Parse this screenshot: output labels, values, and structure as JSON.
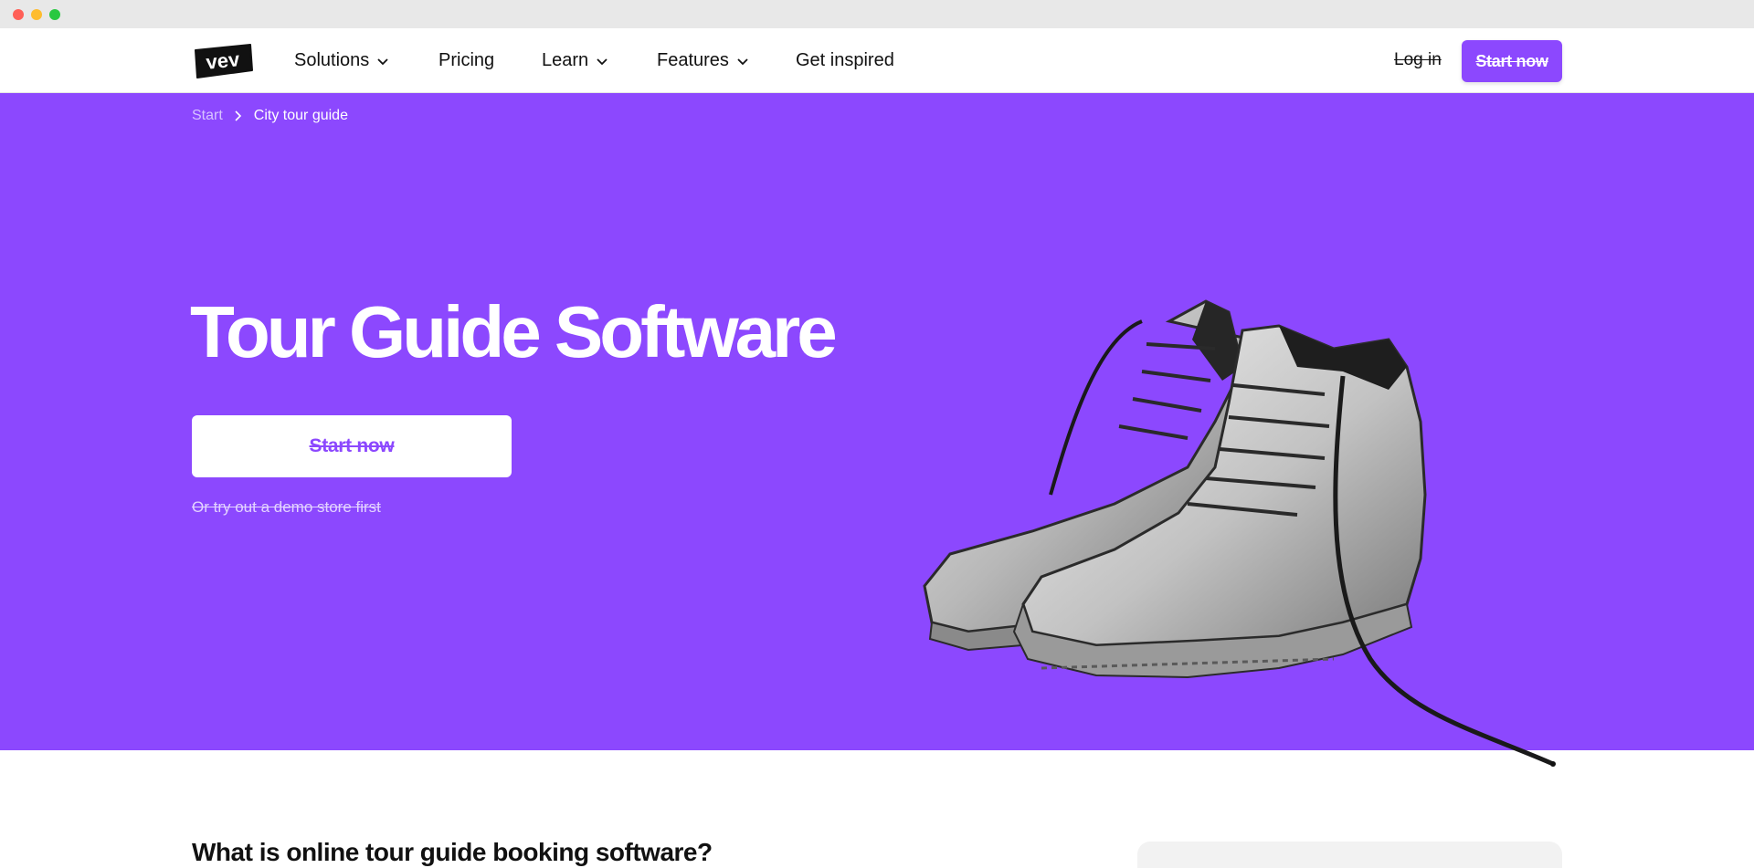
{
  "nav": {
    "logo_text": "vev",
    "items": [
      {
        "label": "Solutions",
        "has_dropdown": true
      },
      {
        "label": "Pricing",
        "has_dropdown": false
      },
      {
        "label": "Learn",
        "has_dropdown": true
      },
      {
        "label": "Features",
        "has_dropdown": true
      },
      {
        "label": "Get inspired",
        "has_dropdown": false
      }
    ],
    "login_label": "Log in",
    "cta_label": "Start now"
  },
  "breadcrumb": {
    "start": "Start",
    "current": "City tour guide"
  },
  "hero": {
    "title": "Tour Guide Software",
    "cta_label": "Start now",
    "demo_link": "Or try out a demo store first",
    "image_subject": "worn-hiking-boots"
  },
  "section": {
    "title": "What is online tour guide booking software?"
  },
  "colors": {
    "brand": "#8c48fe",
    "hero_bg": "#8c48fe",
    "text": "#111111",
    "white": "#ffffff"
  }
}
